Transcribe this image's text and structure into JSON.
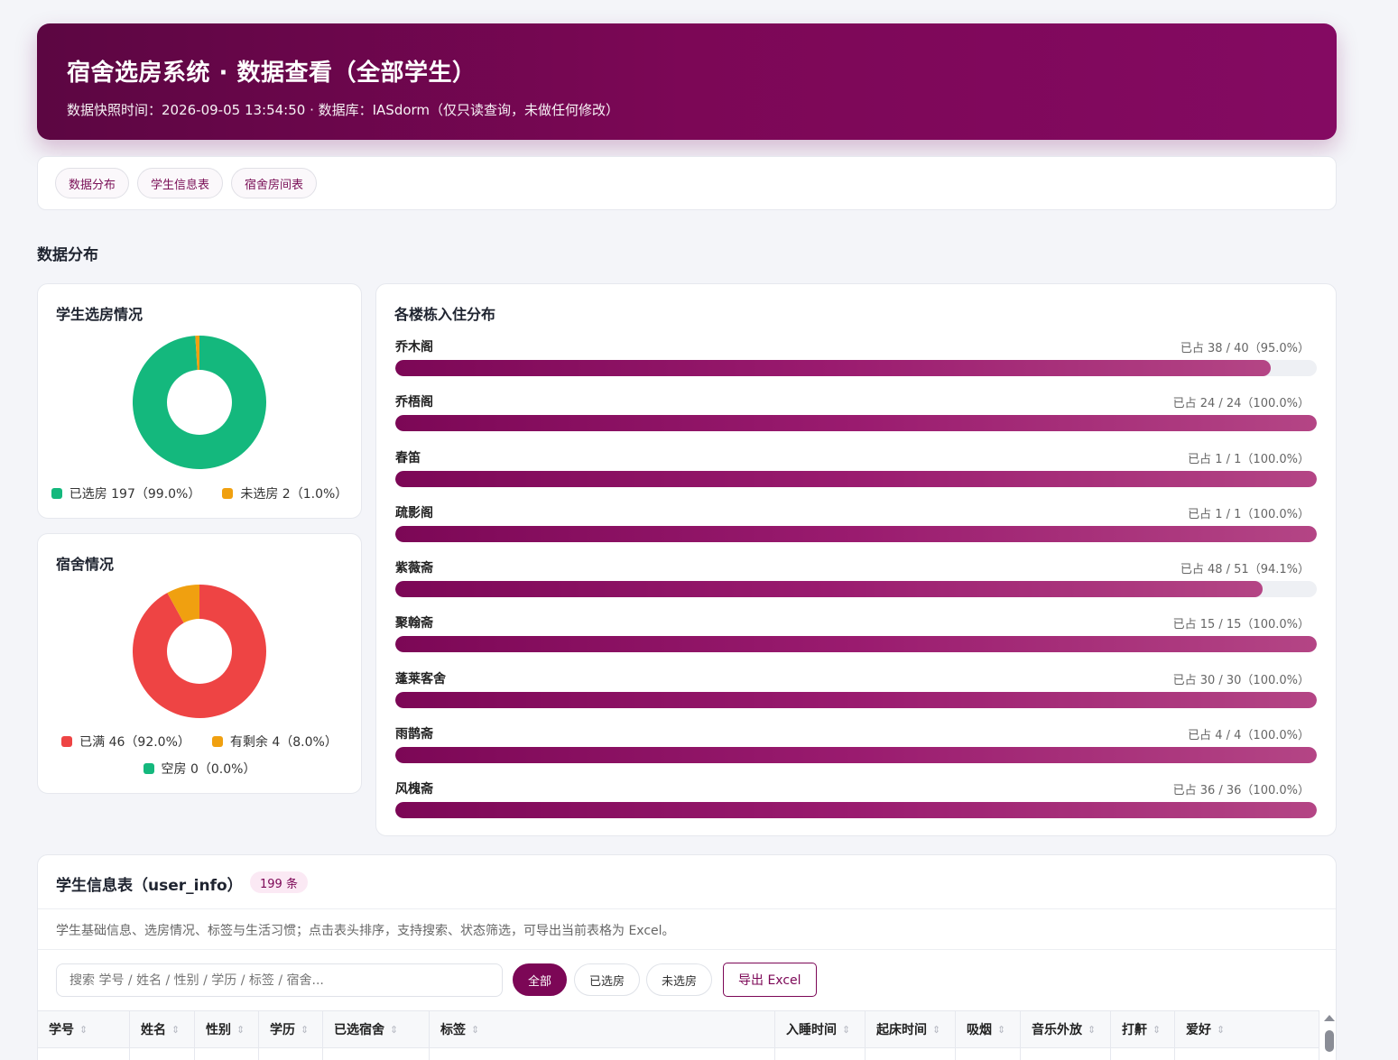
{
  "header": {
    "title": "宿舍选房系统 · 数据查看（全部学生）",
    "subtitle": "数据快照时间：2026-09-05 13:54:50 · 数据库：IASdorm（仅只读查询，未做任何修改）"
  },
  "nav": [
    "数据分布",
    "学生信息表",
    "宿舍房间表"
  ],
  "section_title": "数据分布",
  "chart_data": [
    {
      "type": "pie",
      "title": "学生选房情况",
      "labels": [
        "已选房",
        "未选房"
      ],
      "values": [
        197,
        2
      ],
      "colors": [
        "#14b87d",
        "#f0a010"
      ],
      "legend": [
        "已选房 197（99.0%）",
        "未选房 2（1.0%）"
      ]
    },
    {
      "type": "pie",
      "title": "宿舍情况",
      "labels": [
        "已满",
        "有剩余",
        "空房"
      ],
      "values": [
        46,
        4,
        0
      ],
      "colors": [
        "#ee4444",
        "#f0a010",
        "#14b87d"
      ],
      "legend": [
        "已满 46（92.0%）",
        "有剩余 4（8.0%）",
        "空房 0（0.0%）"
      ]
    },
    {
      "type": "bar",
      "title": "各楼栋入住分布",
      "categories": [
        "乔木阁",
        "乔梧阁",
        "春笛",
        "疏影阁",
        "紫薇斋",
        "聚翰斋",
        "蓬莱客舍",
        "雨鹊斋",
        "风槐斋"
      ],
      "occupied": [
        38,
        24,
        1,
        1,
        48,
        15,
        30,
        4,
        36
      ],
      "capacity": [
        40,
        24,
        1,
        1,
        51,
        15,
        30,
        4,
        36
      ],
      "labels": [
        "已占 38 / 40（95.0%）",
        "已占 24 / 24（100.0%）",
        "已占 1 / 1（100.0%）",
        "已占 1 / 1（100.0%）",
        "已占 48 / 51（94.1%）",
        "已占 15 / 15（100.0%）",
        "已占 30 / 30（100.0%）",
        "已占 4 / 4（100.0%）",
        "已占 36 / 36（100.0%）"
      ]
    }
  ],
  "table": {
    "title": "学生信息表（user_info）",
    "count_badge": "199 条",
    "description": "学生基础信息、选房情况、标签与生活习惯；点击表头排序，支持搜索、状态筛选，可导出当前表格为 Excel。",
    "search_placeholder": "搜索 学号 / 姓名 / 性别 / 学历 / 标签 / 宿舍...",
    "filters": [
      "全部",
      "已选房",
      "未选房"
    ],
    "export_label": "导出 Excel",
    "columns": [
      "学号",
      "姓名",
      "性别",
      "学历",
      "已选宿舍",
      "标签",
      "入睡时间",
      "起床时间",
      "吸烟",
      "音乐外放",
      "打鼾",
      "爱好"
    ]
  },
  "colors": {
    "brand": "#7c0756",
    "chosen": "#14b87d",
    "unchosen": "#f0a010",
    "full": "#ee4444"
  }
}
